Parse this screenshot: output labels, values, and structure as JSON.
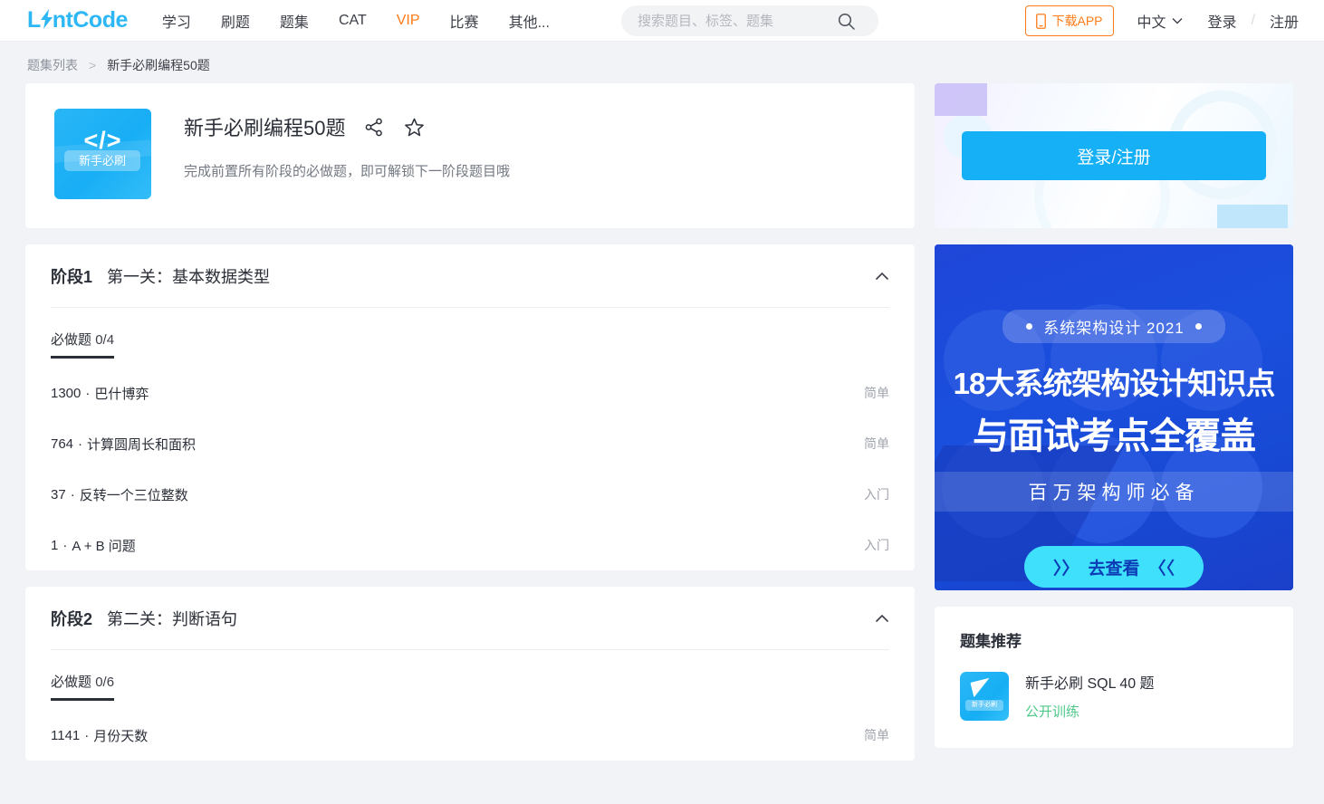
{
  "header": {
    "logo_text_pre": "L",
    "logo_text_post": "ntCode",
    "logo_icon": "lightning-bolt-icon",
    "nav": [
      {
        "label": "学习",
        "active": false
      },
      {
        "label": "刷题",
        "active": false
      },
      {
        "label": "题集",
        "active": false
      },
      {
        "label": "CAT",
        "active": false
      },
      {
        "label": "VIP",
        "active": true
      },
      {
        "label": "比赛",
        "active": false
      },
      {
        "label": "其他...",
        "active": false
      }
    ],
    "search": {
      "placeholder": "搜索题目、标签、题集",
      "value": "",
      "icon": "search-icon"
    },
    "download_app": {
      "label": "下载APP",
      "icon": "phone-icon"
    },
    "language": {
      "label": "中文",
      "icon": "chevron-down-icon"
    },
    "login_label": "登录",
    "separator": "/",
    "register_label": "注册"
  },
  "breadcrumb": {
    "parent": "题集列表",
    "separator": ">",
    "current": "新手必刷编程50题"
  },
  "set": {
    "thumb": {
      "glyph": "</>",
      "tag": "新手必刷"
    },
    "title": "新手必刷编程50题",
    "share_icon": "share-icon",
    "star_icon": "star-outline-icon",
    "description": "完成前置所有阶段的必做题，即可解锁下一阶段题目哦"
  },
  "stages": [
    {
      "number": "阶段1",
      "name": "第一关：基本数据类型",
      "collapse_icon": "chevron-up-icon",
      "tab_label": "必做题",
      "tab_count": "0/4",
      "problems": [
        {
          "id": "1300",
          "sep": "·",
          "name": "巴什博弈",
          "difficulty": "简单"
        },
        {
          "id": "764",
          "sep": "·",
          "name": "计算圆周长和面积",
          "difficulty": "简单"
        },
        {
          "id": "37",
          "sep": "·",
          "name": "反转一个三位整数",
          "difficulty": "入门"
        },
        {
          "id": "1",
          "sep": "·",
          "name": "A + B 问题",
          "difficulty": "入门"
        }
      ]
    },
    {
      "number": "阶段2",
      "name": "第二关：判断语句",
      "collapse_icon": "chevron-up-icon",
      "tab_label": "必做题",
      "tab_count": "0/6",
      "problems": [
        {
          "id": "1141",
          "sep": "·",
          "name": "月份天数",
          "difficulty": "简单"
        }
      ]
    }
  ],
  "sidebar": {
    "login_card": {
      "button_label": "登录/注册"
    },
    "ad": {
      "pill": "系统架构设计 2021",
      "headline1": "18大系统架构设计知识点",
      "headline2": "与面试考点全覆盖",
      "band": "百万架构师必备",
      "cta_prefix": "〉〉",
      "cta_label": "去查看",
      "cta_suffix": "〈〈"
    },
    "recommend": {
      "title": "题集推荐",
      "items": [
        {
          "name": "新手必刷 SQL 40 题",
          "sub": "公开训练",
          "thumb_tag": "新手必刷"
        }
      ]
    }
  },
  "colors": {
    "brand_blue": "#2db8f5",
    "accent_orange": "#ff7b19",
    "page_bg": "#f2f3f7",
    "ad_blue": "#1b4bd6",
    "cta_cyan": "#3ee0fb",
    "green": "#4dc98a"
  }
}
